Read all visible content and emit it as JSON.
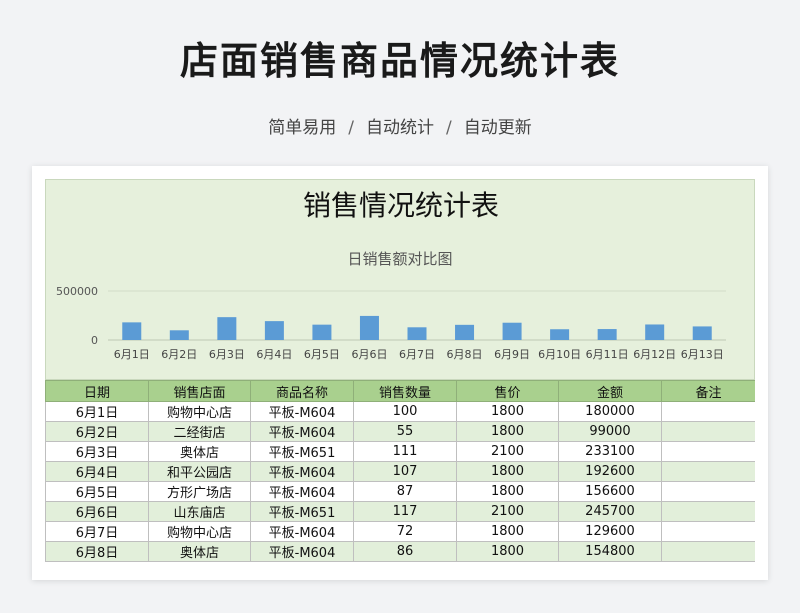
{
  "header": {
    "title": "店面销售商品情况统计表",
    "tags": [
      "简单易用",
      "自动统计",
      "自动更新"
    ],
    "separator": "/"
  },
  "sheet": {
    "title": "销售情况统计表"
  },
  "chart_data": {
    "type": "bar",
    "title": "日销售额对比图",
    "categories": [
      "6月1日",
      "6月2日",
      "6月3日",
      "6月4日",
      "6月5日",
      "6月6日",
      "6月7日",
      "6月8日",
      "6月9日",
      "6月10日",
      "6月11日",
      "6月12日",
      "6月13日"
    ],
    "values": [
      180000,
      99000,
      233100,
      192600,
      156600,
      245700,
      129600,
      154800,
      176400,
      109800,
      111600,
      158400,
      138600
    ],
    "ylim": [
      0,
      500000
    ],
    "yticks": [
      "0",
      "500000"
    ],
    "bar_color": "#5b9bd5",
    "gridlines": true
  },
  "table": {
    "columns": [
      "日期",
      "销售店面",
      "商品名称",
      "销售数量",
      "售价",
      "金额",
      "备注"
    ],
    "rows": [
      [
        "6月1日",
        "购物中心店",
        "平板-M604",
        "100",
        "1800",
        "180000",
        ""
      ],
      [
        "6月2日",
        "二经街店",
        "平板-M604",
        "55",
        "1800",
        "99000",
        ""
      ],
      [
        "6月3日",
        "奥体店",
        "平板-M651",
        "111",
        "2100",
        "233100",
        ""
      ],
      [
        "6月4日",
        "和平公园店",
        "平板-M604",
        "107",
        "1800",
        "192600",
        ""
      ],
      [
        "6月5日",
        "方形广场店",
        "平板-M604",
        "87",
        "1800",
        "156600",
        ""
      ],
      [
        "6月6日",
        "山东庙店",
        "平板-M651",
        "117",
        "2100",
        "245700",
        ""
      ],
      [
        "6月7日",
        "购物中心店",
        "平板-M604",
        "72",
        "1800",
        "129600",
        ""
      ],
      [
        "6月8日",
        "奥体店",
        "平板-M604",
        "86",
        "1800",
        "154800",
        ""
      ]
    ]
  }
}
